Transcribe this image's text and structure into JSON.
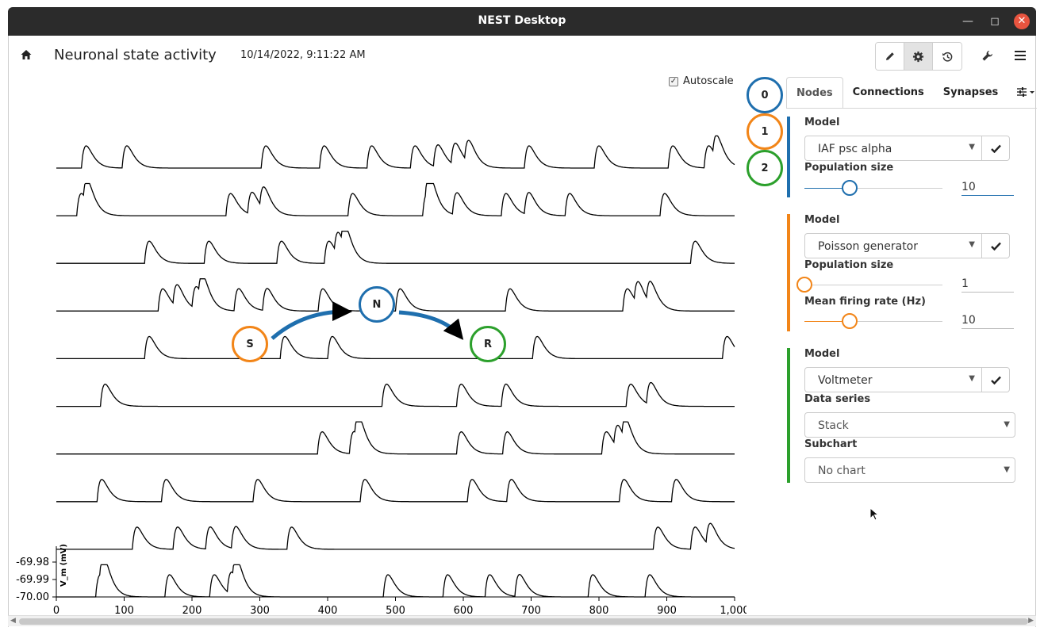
{
  "window": {
    "title": "NEST Desktop"
  },
  "header": {
    "title": "Neuronal state activity",
    "timestamp": "10/14/2022, 9:11:22 AM"
  },
  "chart_controls": {
    "autoscale_label": "Autoscale",
    "autoscale_checked": true
  },
  "network": {
    "nodes": [
      {
        "label": "S",
        "color": "#f28518"
      },
      {
        "label": "N",
        "color": "#1f6fae"
      },
      {
        "label": "R",
        "color": "#2ca02c"
      }
    ]
  },
  "node_index": [
    {
      "label": "0",
      "color": "#1f6fae"
    },
    {
      "label": "1",
      "color": "#f28518"
    },
    {
      "label": "2",
      "color": "#2ca02c"
    }
  ],
  "tabs": [
    "Nodes",
    "Connections",
    "Synapses"
  ],
  "panels": {
    "neuron": {
      "color": "#1f6fae",
      "model_label": "Model",
      "model": "IAF psc alpha",
      "population_label": "Population size",
      "population": "10",
      "population_fraction": 0.33
    },
    "generator": {
      "color": "#f28518",
      "model_label": "Model",
      "model": "Poisson generator",
      "population_label": "Population size",
      "population": "1",
      "population_fraction": 0.0,
      "rate_label": "Mean firing rate (Hz)",
      "rate": "10",
      "rate_fraction": 0.33
    },
    "recorder": {
      "color": "#2ca02c",
      "model_label": "Model",
      "model": "Voltmeter",
      "data_series_label": "Data series",
      "data_series": "Stack",
      "subchart_label": "Subchart",
      "subchart": "No chart"
    }
  },
  "chart_data": {
    "type": "line",
    "xlabel": "",
    "ylabel": "V_m (mV)",
    "xlim": [
      0,
      1000
    ],
    "ylim": [
      -70.0,
      -69.975
    ],
    "x_ticks": [
      "0",
      "100",
      "200",
      "300",
      "400",
      "500",
      "600",
      "700",
      "800",
      "900",
      "1,000"
    ],
    "y_ticks": [
      "-69.98",
      "-69.99",
      "-70.00"
    ],
    "stack_order": "top-to-bottom",
    "series": [
      {
        "spikes": [
          37,
          97,
          302,
          388,
          458,
          522,
          556,
          582,
          602,
          690,
          793,
          902,
          955,
          968
        ]
      },
      {
        "spikes": [
          30,
          40,
          250,
          282,
          300,
          430,
          540,
          544,
          584,
          656,
          690,
          750,
          890
        ]
      },
      {
        "spikes": [
          130,
          218,
          325,
          395,
          410,
          420,
          935
        ]
      },
      {
        "spikes": [
          150,
          172,
          200,
          210,
          262,
          304,
          386,
          500,
          662,
          835,
          852,
          870
        ]
      },
      {
        "spikes": [
          130,
          330,
          400,
          702,
          982
        ]
      },
      {
        "spikes": [
          65,
          480,
          590,
          656,
          840,
          870
        ]
      },
      {
        "spikes": [
          385,
          432,
          440,
          590,
          658,
          804,
          822,
          834
        ]
      },
      {
        "spikes": [
          60,
          155,
          290,
          448,
          606,
          664,
          830,
          907
        ]
      },
      {
        "spikes": [
          112,
          172,
          220,
          258,
          340,
          880,
          935,
          958
        ]
      },
      {
        "spikes": [
          58,
          64,
          160,
          226,
          252,
          260,
          482,
          570,
          632,
          676,
          784,
          868
        ]
      }
    ]
  }
}
